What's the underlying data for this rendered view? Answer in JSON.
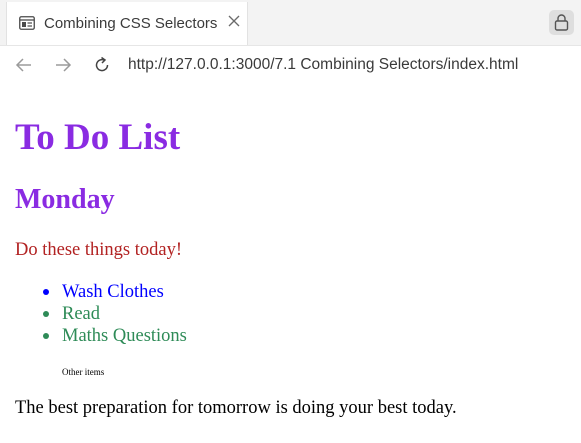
{
  "browser": {
    "tab_title": "Combining CSS Selectors",
    "tab_icon": "page-icon",
    "close_icon": "close-icon",
    "lock_icon": "lock-icon",
    "url": "http://127.0.0.1:3000/7.1 Combining Selectors/index.html"
  },
  "page": {
    "heading": "To Do List",
    "day": "Monday",
    "intro": "Do these things today!",
    "items": [
      {
        "label": "Wash Clothes",
        "color": "#0000ff"
      },
      {
        "label": "Read",
        "color": "#2e8b57"
      },
      {
        "label": "Maths Questions",
        "color": "#2e8b57"
      }
    ],
    "other": "Other items",
    "quote": "The best preparation for tomorrow is doing your best today."
  },
  "colors": {
    "heading": "#8a2be2",
    "intro": "#b22222"
  }
}
